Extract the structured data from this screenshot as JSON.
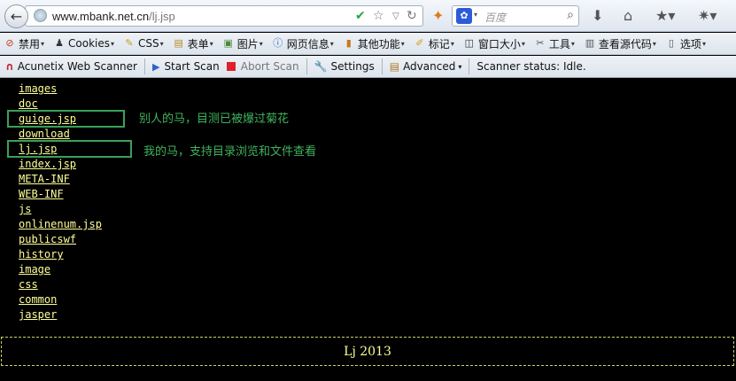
{
  "browser": {
    "url_host": "www.mbank.net.cn",
    "url_path": "/lj.jsp",
    "search_placeholder": "百度"
  },
  "bookmarks": [
    {
      "label": "禁用",
      "icon": "no-entry-icon",
      "color": "#d2381c"
    },
    {
      "label": "Cookies",
      "icon": "person-icon",
      "color": "#333333"
    },
    {
      "label": "CSS",
      "icon": "pencil-icon",
      "color": "#c99a14"
    },
    {
      "label": "表单",
      "icon": "form-icon",
      "color": "#b58a2a"
    },
    {
      "label": "图片",
      "icon": "image-icon",
      "color": "#4a8a3a"
    },
    {
      "label": "网页信息",
      "icon": "info-icon",
      "color": "#2a5fb5"
    },
    {
      "label": "其他功能",
      "icon": "book-icon",
      "color": "#c57a1c"
    },
    {
      "label": "标记",
      "icon": "marker-icon",
      "color": "#d39a1a"
    },
    {
      "label": "窗口大小",
      "icon": "resize-icon",
      "color": "#333333"
    },
    {
      "label": "工具",
      "icon": "tools-icon",
      "color": "#555555"
    },
    {
      "label": "查看源代码",
      "icon": "source-icon",
      "color": "#555555"
    },
    {
      "label": "选项",
      "icon": "options-icon",
      "color": "#555555"
    }
  ],
  "acunetix": {
    "title": "Acunetix Web Scanner",
    "start_scan": "Start Scan",
    "abort_scan": "Abort Scan",
    "settings": "Settings",
    "advanced": "Advanced",
    "status": "Scanner status: Idle."
  },
  "dir_listing": [
    "images",
    "doc",
    "guige.jsp",
    "download",
    "lj.jsp",
    "index.jsp",
    "META-INF",
    "WEB-INF",
    "js",
    "onlinenum.jsp",
    "publicswf",
    "history",
    "image",
    "css",
    "common",
    "jasper"
  ],
  "annotations": {
    "others_shell": "别人的马，目测已被爆过菊花",
    "my_shell": "我的马，支持目录浏览和文件查看"
  },
  "footer": "Lj 2013",
  "colors": {
    "link": "#ffff99",
    "annotation": "#3fb35e",
    "highlight_box": "#3aa05a",
    "page_bg": "#000000"
  }
}
